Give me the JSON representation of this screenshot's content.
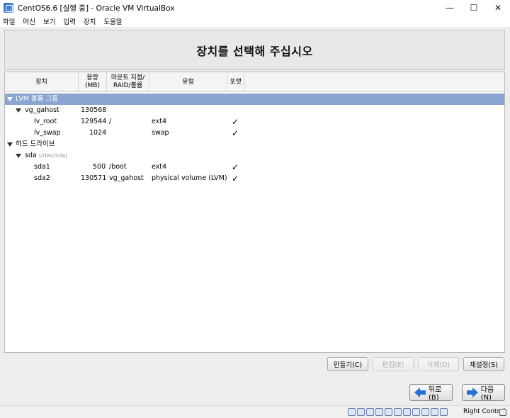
{
  "window": {
    "title": "CentOS6.6 [실행 중] - Oracle VM VirtualBox",
    "controls": [
      "—",
      "☐",
      "✕"
    ]
  },
  "menu": [
    "파일",
    "머신",
    "보기",
    "입력",
    "장치",
    "도움말"
  ],
  "header": {
    "title": "장치를 선택해 주십시오"
  },
  "columns": {
    "device": "장치",
    "size_line1": "용량",
    "size_line2": "(MB)",
    "mount_line1": "마운트 지점/",
    "mount_line2": "RAID/볼륨",
    "type": "유형",
    "format": "포맷"
  },
  "rows": [
    {
      "device": "LVM 볼륨 그룹",
      "sub": "",
      "size": "",
      "mount": "",
      "type": "",
      "format": ""
    },
    {
      "device": "vg_gahost",
      "sub": "",
      "size": "130568",
      "mount": "",
      "type": "",
      "format": ""
    },
    {
      "device": "lv_root",
      "sub": "",
      "size": "129544",
      "mount": "/",
      "type": "ext4",
      "format": "✓"
    },
    {
      "device": "lv_swap",
      "sub": "",
      "size": "1024",
      "mount": "",
      "type": "swap",
      "format": "✓"
    },
    {
      "device": "하드 드라이브",
      "sub": "",
      "size": "",
      "mount": "",
      "type": "",
      "format": ""
    },
    {
      "device": "sda",
      "sub": "(/dev/sda)",
      "size": "",
      "mount": "",
      "type": "",
      "format": ""
    },
    {
      "device": "sda1",
      "sub": "",
      "size": "500",
      "mount": "/boot",
      "type": "ext4",
      "format": "✓"
    },
    {
      "device": "sda2",
      "sub": "",
      "size": "130571",
      "mount": "vg_gahost",
      "type": "physical volume (LVM)",
      "format": "✓"
    }
  ],
  "actions": {
    "create": "만들기(C)",
    "edit": "편집(E)",
    "delete": "삭제(D)",
    "reset": "재설정(S)"
  },
  "nav": {
    "back": "뒤로(B)",
    "next": "다음(N)"
  },
  "statusbar": {
    "host_key": "Right Control"
  }
}
